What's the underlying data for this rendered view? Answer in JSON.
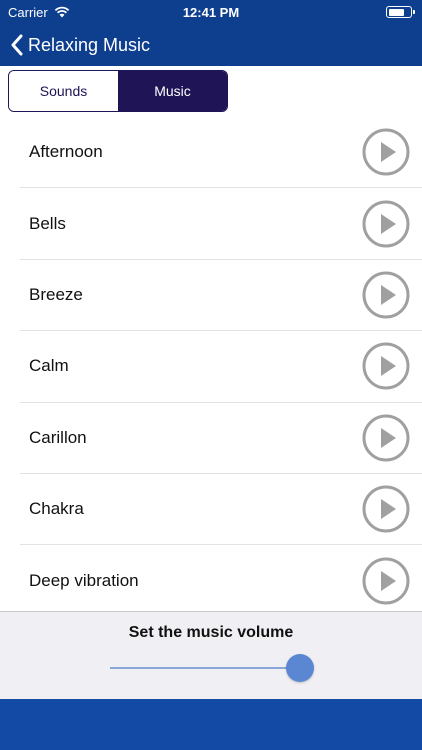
{
  "status": {
    "carrier": "Carrier",
    "time": "12:41 PM",
    "battery_level": 0.75
  },
  "nav": {
    "title": "Relaxing Music"
  },
  "tabs": [
    {
      "label": "Sounds",
      "selected": false
    },
    {
      "label": "Music",
      "selected": true
    }
  ],
  "tracks": [
    "Afternoon",
    "Bells",
    "Breeze",
    "Calm",
    "Carillon",
    "Chakra",
    "Deep vibration"
  ],
  "volume": {
    "title": "Set the music volume",
    "level": 0.95
  },
  "colors": {
    "nav": "#0e3f8f",
    "tab_active": "#1e1456",
    "slider_thumb": "#5b86d2",
    "footer": "#134aa6",
    "play_icon": "#a0a0a0"
  }
}
